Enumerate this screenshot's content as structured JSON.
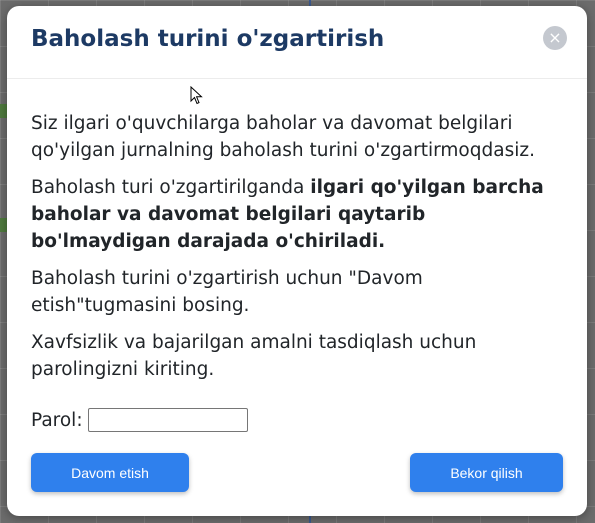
{
  "modal": {
    "title": "Baholash turini o'zgartirish",
    "close_icon": "×",
    "paragraph1": "Siz ilgari o'quvchilarga baholar va davomat belgilari qo'yilgan jurnalning baholash turini o'zgartirmoqdasiz.",
    "paragraph2_plain": "Baholash turi o'zgartirilganda ",
    "paragraph2_bold": "ilgari qo'yilgan barcha baholar va davomat belgilari qaytarib bo'lmaydigan darajada o'chiriladi.",
    "paragraph3": "Baholash turini o'zgartirish uchun \"Davom etish\"tugmasini bosing.",
    "paragraph4": "Xavfsizlik va bajarilgan amalni tasdiqlash uchun parolingizni kiriting.",
    "password_label": "Parol:",
    "password_value": "",
    "continue_label": "Davom etish",
    "cancel_label": "Bekor qilish"
  },
  "colors": {
    "title": "#1d3a64",
    "button": "#2f80ed",
    "close_bg": "#c4c8cf",
    "overlay": "#5f5f5f"
  },
  "icons": {
    "close": "close-icon",
    "cursor": "mouse-pointer-icon"
  }
}
